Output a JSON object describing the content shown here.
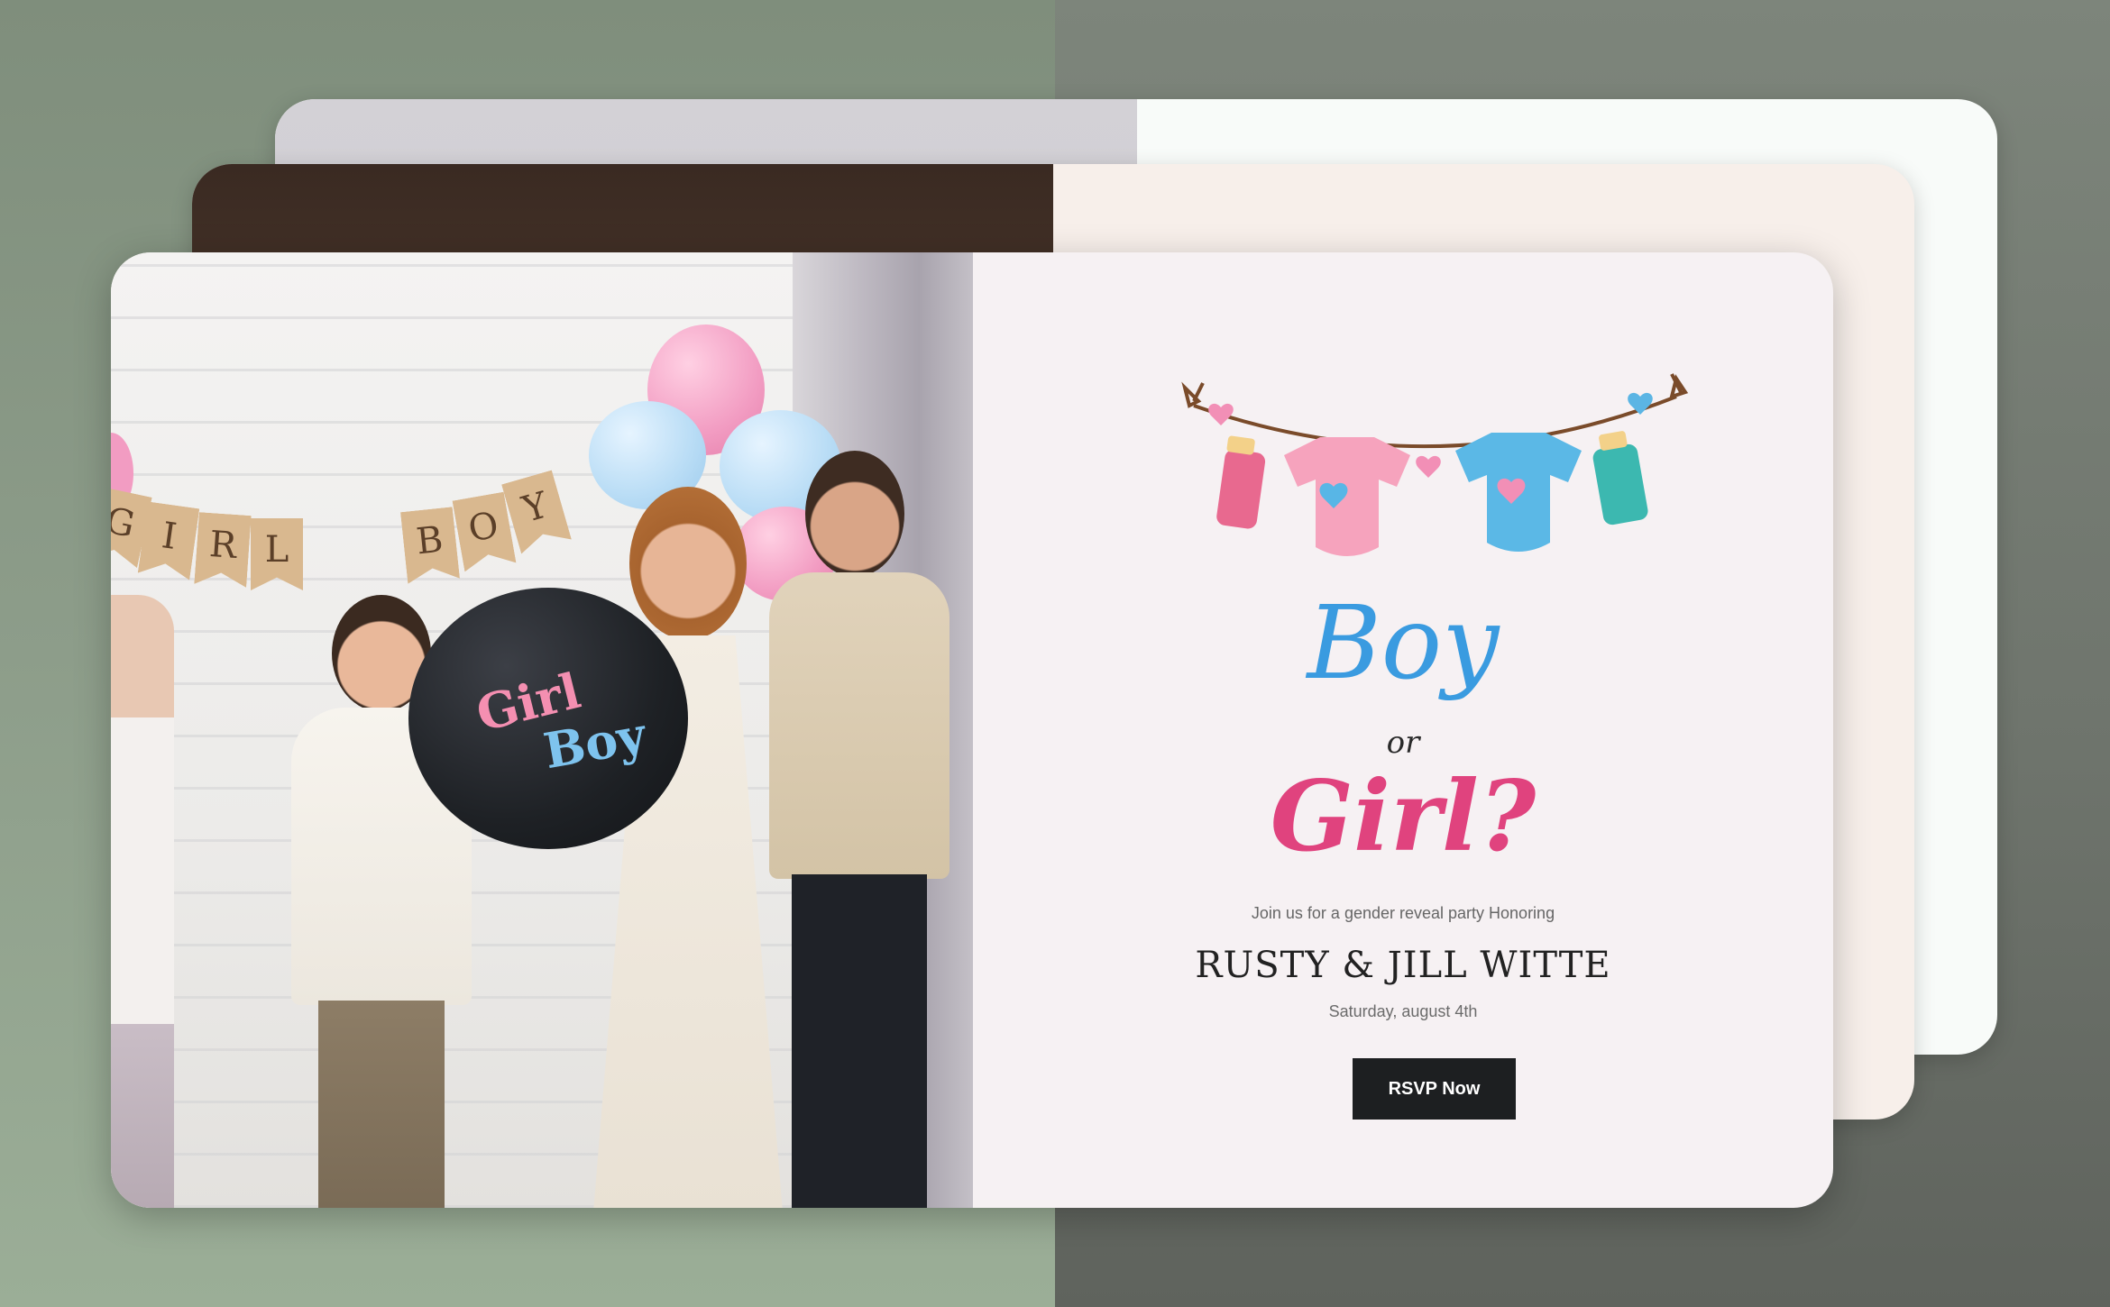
{
  "invitation": {
    "title_boy": "Boy",
    "title_or": "or",
    "title_girl": "Girl?",
    "intro": "Join us for a gender reveal party Honoring",
    "names": "RUSTY & JILL WITTE",
    "date": "Saturday, august 4th",
    "rsvp_label": "RSVP Now"
  },
  "photo": {
    "banner_letters": [
      "G",
      "I",
      "R",
      "L",
      "B",
      "O",
      "Y"
    ],
    "balloon_girl": "Girl",
    "balloon_boy": "Boy"
  },
  "colors": {
    "boy_blue": "#3a9be0",
    "girl_pink": "#e0437e",
    "button_dark": "#1d1f21",
    "card_front_bg": "#f6f1f3",
    "card_mid_bg": "#f7efea",
    "card_back_bg": "#f8fbf9"
  },
  "icons": {
    "garland": "baby-clothes-garland-icon"
  }
}
